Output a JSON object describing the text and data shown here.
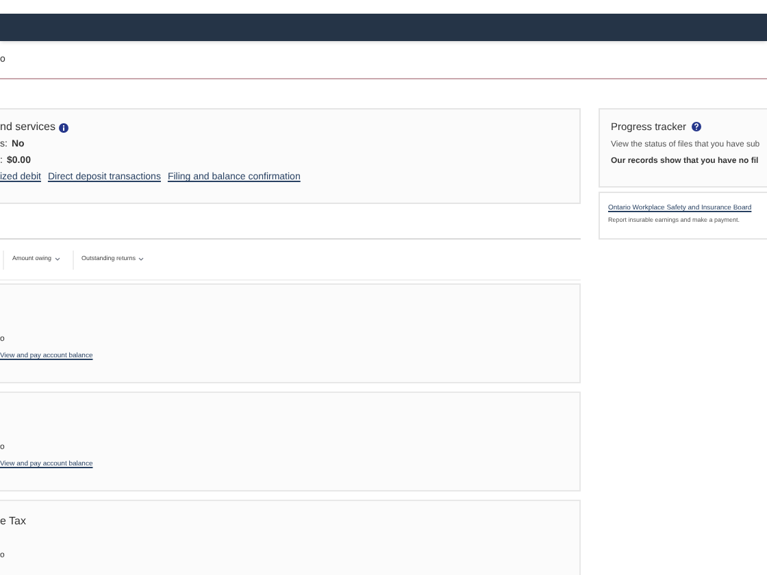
{
  "page_title_fragment": "o",
  "services_card": {
    "title": "nd services",
    "rows": [
      {
        "label": "s:",
        "value": "No"
      },
      {
        "label": ":",
        "value": "$0.00"
      }
    ],
    "links": [
      "ized debit",
      "Direct deposit transactions",
      "Filing and balance confirmation"
    ]
  },
  "filters": [
    {
      "label": "Amount owing"
    },
    {
      "label": "Outstanding returns"
    }
  ],
  "accounts": [
    {
      "fragment": "o",
      "link": "View and pay account balance"
    },
    {
      "fragment": "o",
      "link": "View and pay account balance"
    },
    {
      "title": "e Tax",
      "fragment": "o"
    }
  ],
  "progress_tracker": {
    "title": "Progress tracker",
    "description": "View the status of files that you have sub",
    "status": "Our records show that you have no fil"
  },
  "wsib": {
    "link": "Ontario Workplace Safety and Insurance Board",
    "description": "Report insurable earnings and make a payment."
  }
}
